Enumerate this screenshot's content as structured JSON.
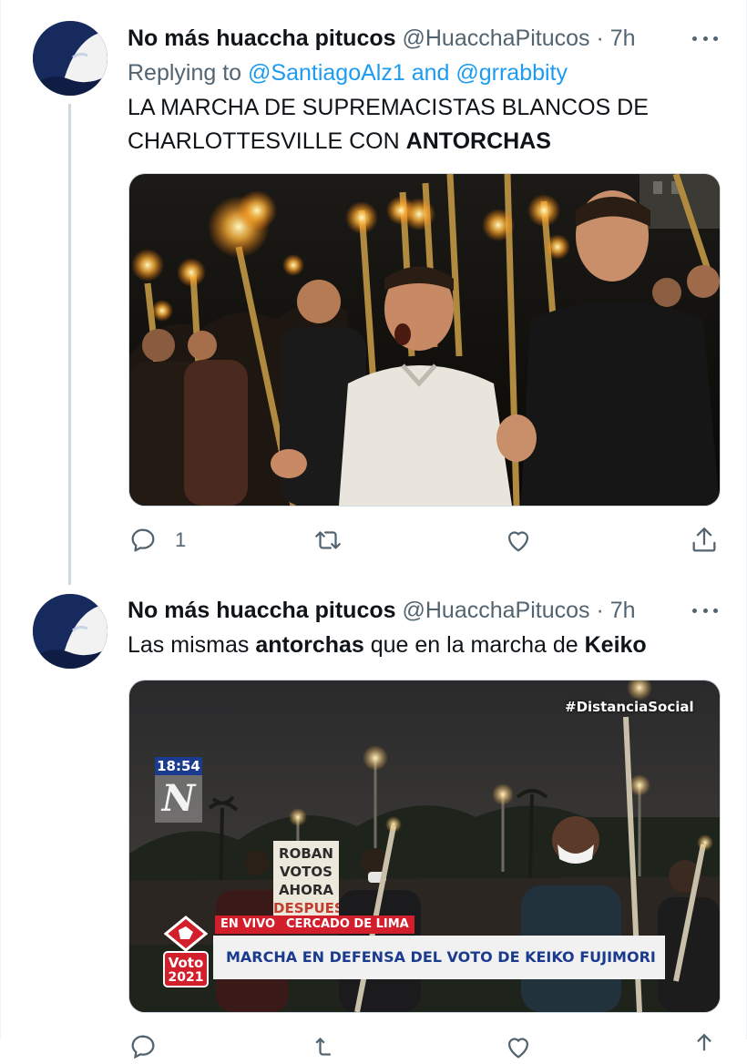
{
  "tweets": [
    {
      "name": "No más huaccha pitucos",
      "handle": "@HuacchaPitucos",
      "sep": " · ",
      "time": "7h",
      "replying_prefix": "Replying to ",
      "replying_user1": "@SantiagoAlz1",
      "replying_and": " and ",
      "replying_user2": "@grrabbity",
      "text_line1": "LA MARCHA DE SUPREMACISTAS BLANCOS DE",
      "text_line2_plain": "CHARLOTTESVILLE CON ",
      "text_line2_bold": "ANTORCHAS",
      "reply_count": "1"
    },
    {
      "name": "No más huaccha pitucos",
      "handle": "@HuacchaPitucos",
      "sep": " · ",
      "time": "7h",
      "text_part1": "Las mismas ",
      "text_bold1": "antorchas",
      "text_part2": " que en la marcha de ",
      "text_bold2": "Keiko",
      "broadcast": {
        "hashtag": "#DistanciaSocial",
        "clock": "18:54",
        "channel_logo": "N",
        "sign_lines": [
          "ROBAN",
          "VOTOS",
          "AHORA",
          "DESPUES"
        ],
        "live_label": "EN VIVO",
        "location_label": "CERCADO DE LIMA",
        "election_badge_top": "Voto",
        "election_badge_year": "2021",
        "headline": "MARCHA EN DEFENSA DEL VOTO DE KEIKO FUJIMORI"
      }
    }
  ],
  "colors": {
    "link": "#1d9bf0",
    "secondary_text": "#536471",
    "primary_text": "#0f1419",
    "thread_line": "#cfd9de"
  },
  "icons": [
    "reply-icon",
    "retweet-icon",
    "like-icon",
    "share-icon",
    "more-icon"
  ]
}
